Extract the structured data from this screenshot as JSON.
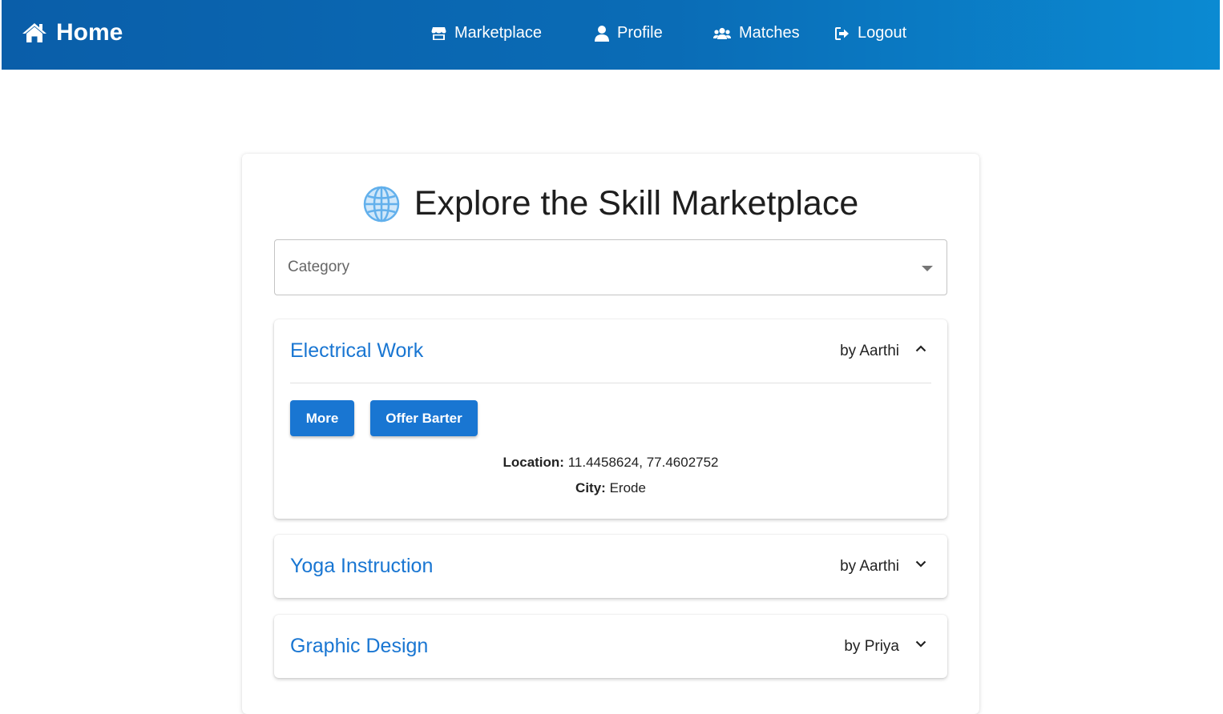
{
  "nav": {
    "home_label": "Home",
    "links": [
      {
        "label": "Marketplace",
        "icon": "store-icon"
      },
      {
        "label": "Profile",
        "icon": "user-icon"
      },
      {
        "label": "Matches",
        "icon": "users-icon"
      },
      {
        "label": "Logout",
        "icon": "logout-icon"
      }
    ]
  },
  "page": {
    "title": "Explore the Skill Marketplace",
    "title_icon": "globe-icon"
  },
  "filter": {
    "category_label": "Category"
  },
  "listings": [
    {
      "title": "Electrical Work",
      "author": "by Aarthi",
      "expanded": true,
      "more_label": "More",
      "barter_label": "Offer Barter",
      "location_label": "Location:",
      "location_value": "11.4458624, 77.4602752",
      "city_label": "City:",
      "city_value": "Erode"
    },
    {
      "title": "Yoga Instruction",
      "author": "by Aarthi",
      "expanded": false
    },
    {
      "title": "Graphic Design",
      "author": "by Priya",
      "expanded": false
    }
  ],
  "colors": {
    "nav_gradient_start": "#0a5ea9",
    "nav_gradient_end": "#0b8ad2",
    "accent": "#1976d2"
  }
}
